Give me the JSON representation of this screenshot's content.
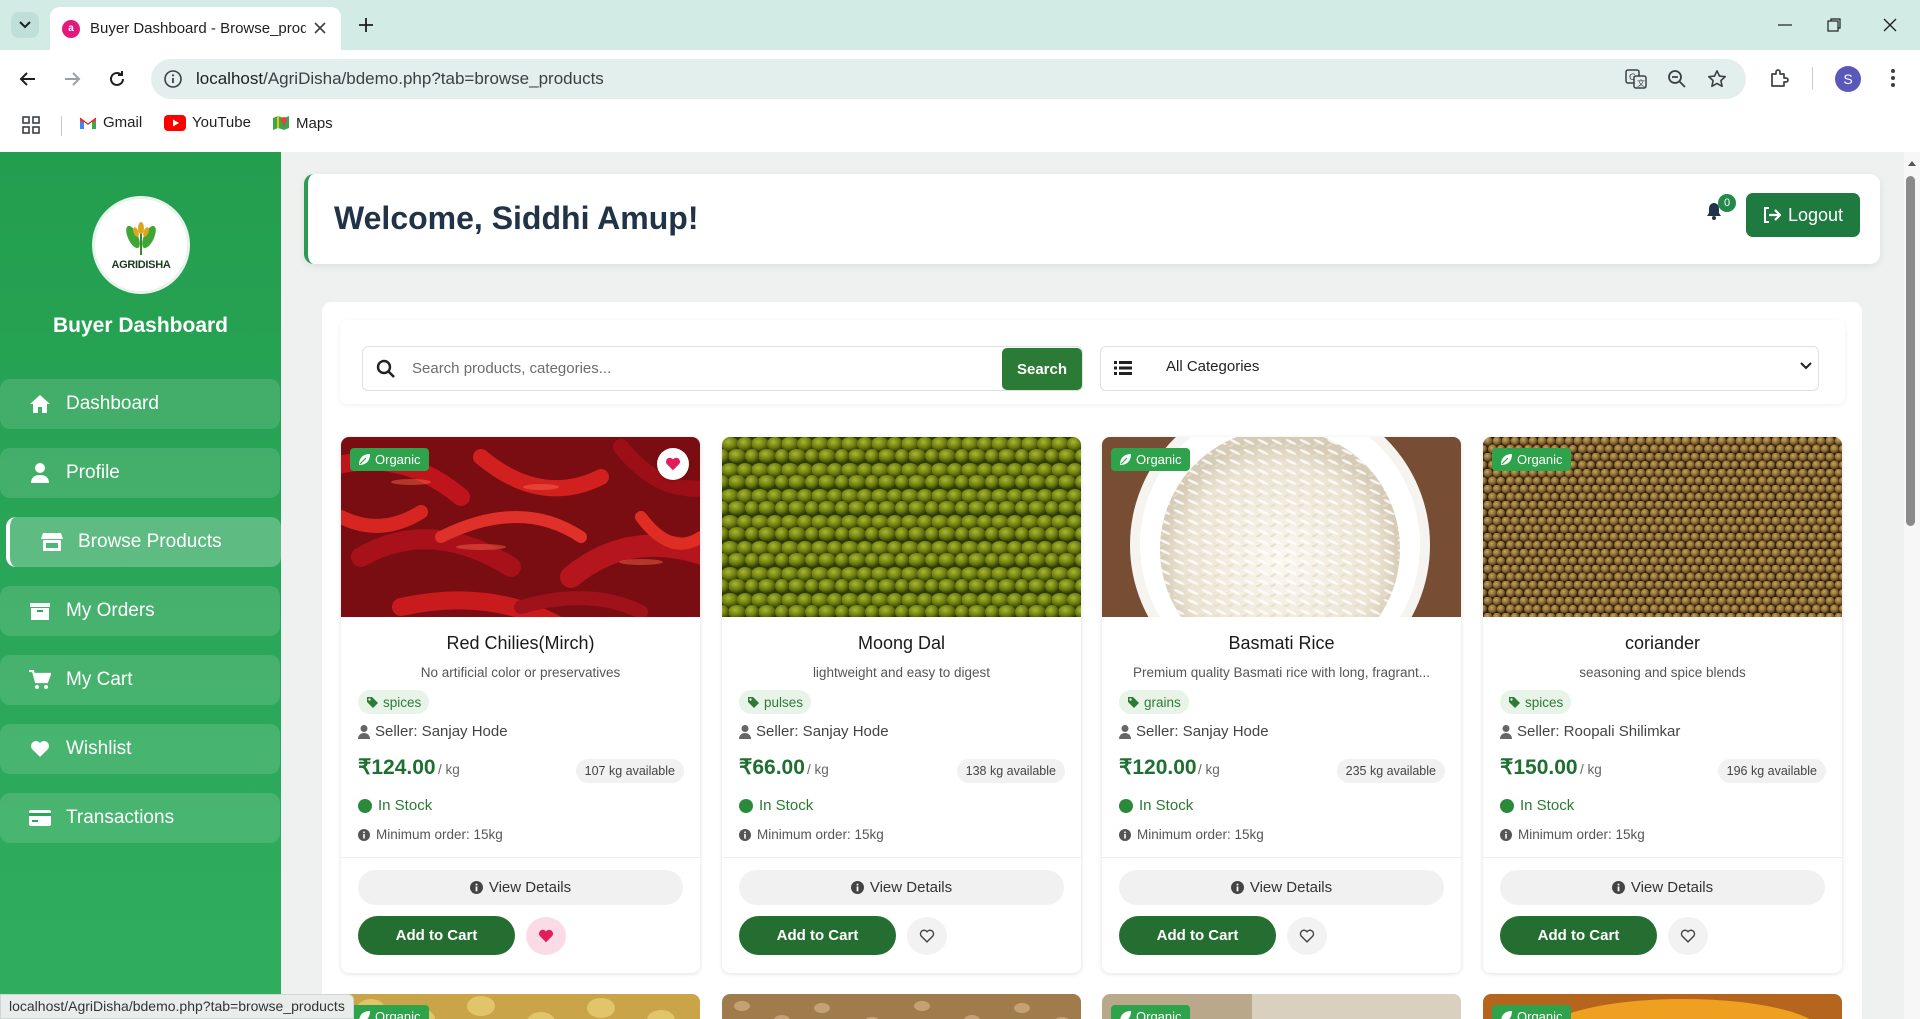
{
  "browser": {
    "tab_title": "Buyer Dashboard - Browse_products",
    "url_host": "localhost",
    "url_path": "/AgriDisha/bdemo.php?tab=browse_products",
    "profile_initial": "S",
    "bookmarks": [
      "Gmail",
      "YouTube",
      "Maps"
    ],
    "status_url": "localhost/AgriDisha/bdemo.php?tab=browse_products"
  },
  "sidebar": {
    "logo_text": "AGRIDISHA",
    "title": "Buyer Dashboard",
    "items": [
      {
        "label": "Dashboard",
        "icon": "home-icon"
      },
      {
        "label": "Profile",
        "icon": "user-icon"
      },
      {
        "label": "Browse Products",
        "icon": "store-icon",
        "active": true
      },
      {
        "label": "My Orders",
        "icon": "box-icon"
      },
      {
        "label": "My Cart",
        "icon": "cart-icon"
      },
      {
        "label": "Wishlist",
        "icon": "heart-icon"
      },
      {
        "label": "Transactions",
        "icon": "credit-card-icon"
      }
    ]
  },
  "header": {
    "welcome": "Welcome, Siddhi Amup!",
    "notification_count": "0",
    "logout_label": "Logout"
  },
  "search": {
    "placeholder": "Search products, categories...",
    "button_label": "Search",
    "category_selected": "All Categories"
  },
  "products": [
    {
      "name": "Red Chilies(Mirch)",
      "description": "No artificial color or preservatives",
      "category": "spices",
      "seller": "Seller: Sanjay Hode",
      "price": "₹124.00",
      "unit": "/ kg",
      "available": "107 kg available",
      "stock": "In Stock",
      "min_order": "Minimum order: 15kg",
      "organic": true,
      "organic_label": "Organic",
      "wishlisted": true
    },
    {
      "name": "Moong Dal",
      "description": "lightweight and easy to digest",
      "category": "pulses",
      "seller": "Seller: Sanjay Hode",
      "price": "₹66.00",
      "unit": "/ kg",
      "available": "138 kg available",
      "stock": "In Stock",
      "min_order": "Minimum order: 15kg",
      "organic": false,
      "wishlisted": false
    },
    {
      "name": "Basmati Rice",
      "description": "Premium quality Basmati rice with long, fragrant...",
      "category": "grains",
      "seller": "Seller: Sanjay Hode",
      "price": "₹120.00",
      "unit": "/ kg",
      "available": "235 kg available",
      "stock": "In Stock",
      "min_order": "Minimum order: 15kg",
      "organic": true,
      "organic_label": "Organic",
      "wishlisted": false
    },
    {
      "name": "coriander",
      "description": "seasoning and spice blends",
      "category": "spices",
      "seller": "Seller: Roopali Shilimkar",
      "price": "₹150.00",
      "unit": "/ kg",
      "available": "196 kg available",
      "stock": "In Stock",
      "min_order": "Minimum order: 15kg",
      "organic": true,
      "organic_label": "Organic",
      "wishlisted": false
    }
  ],
  "buttons": {
    "view_details": "View Details",
    "add_to_cart": "Add to Cart"
  },
  "second_row_organic_label": "Organic",
  "colors": {
    "sidebar": "#2aa658",
    "primary_dark": "#1e7a3e",
    "organic_badge": "#2fa34b",
    "wishlist_active": "#e11d5a"
  }
}
